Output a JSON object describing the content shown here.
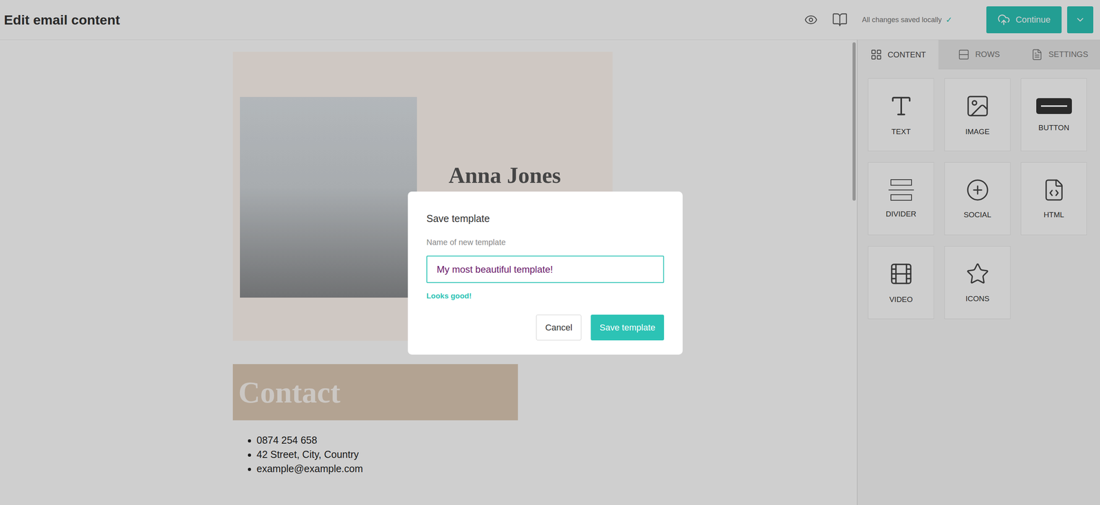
{
  "header": {
    "title": "Edit email content",
    "status": {
      "text": "All changes saved locally",
      "mark": "✓"
    },
    "continue_button": "Continue"
  },
  "sidebar": {
    "tabs": [
      {
        "label": "CONTENT",
        "selected": true
      },
      {
        "label": "ROWS",
        "selected": false
      },
      {
        "label": "SETTINGS",
        "selected": false
      }
    ],
    "tiles": [
      "TEXT",
      "IMAGE",
      "BUTTON",
      "DIVIDER",
      "SOCIAL",
      "HTML",
      "VIDEO",
      "ICONS"
    ]
  },
  "email": {
    "name": "Anna Jones",
    "contact_heading": "Contact",
    "contact_items": [
      "0874 254 658",
      "42 Street, City, Country",
      "example@example.com"
    ]
  },
  "dialog": {
    "open": true,
    "title": "Save template",
    "label": "Name of new template",
    "value": "My most beautiful template!",
    "validation": "Looks good!",
    "valid": true,
    "buttons": {
      "cancel": "Cancel",
      "save": "Save template"
    }
  }
}
